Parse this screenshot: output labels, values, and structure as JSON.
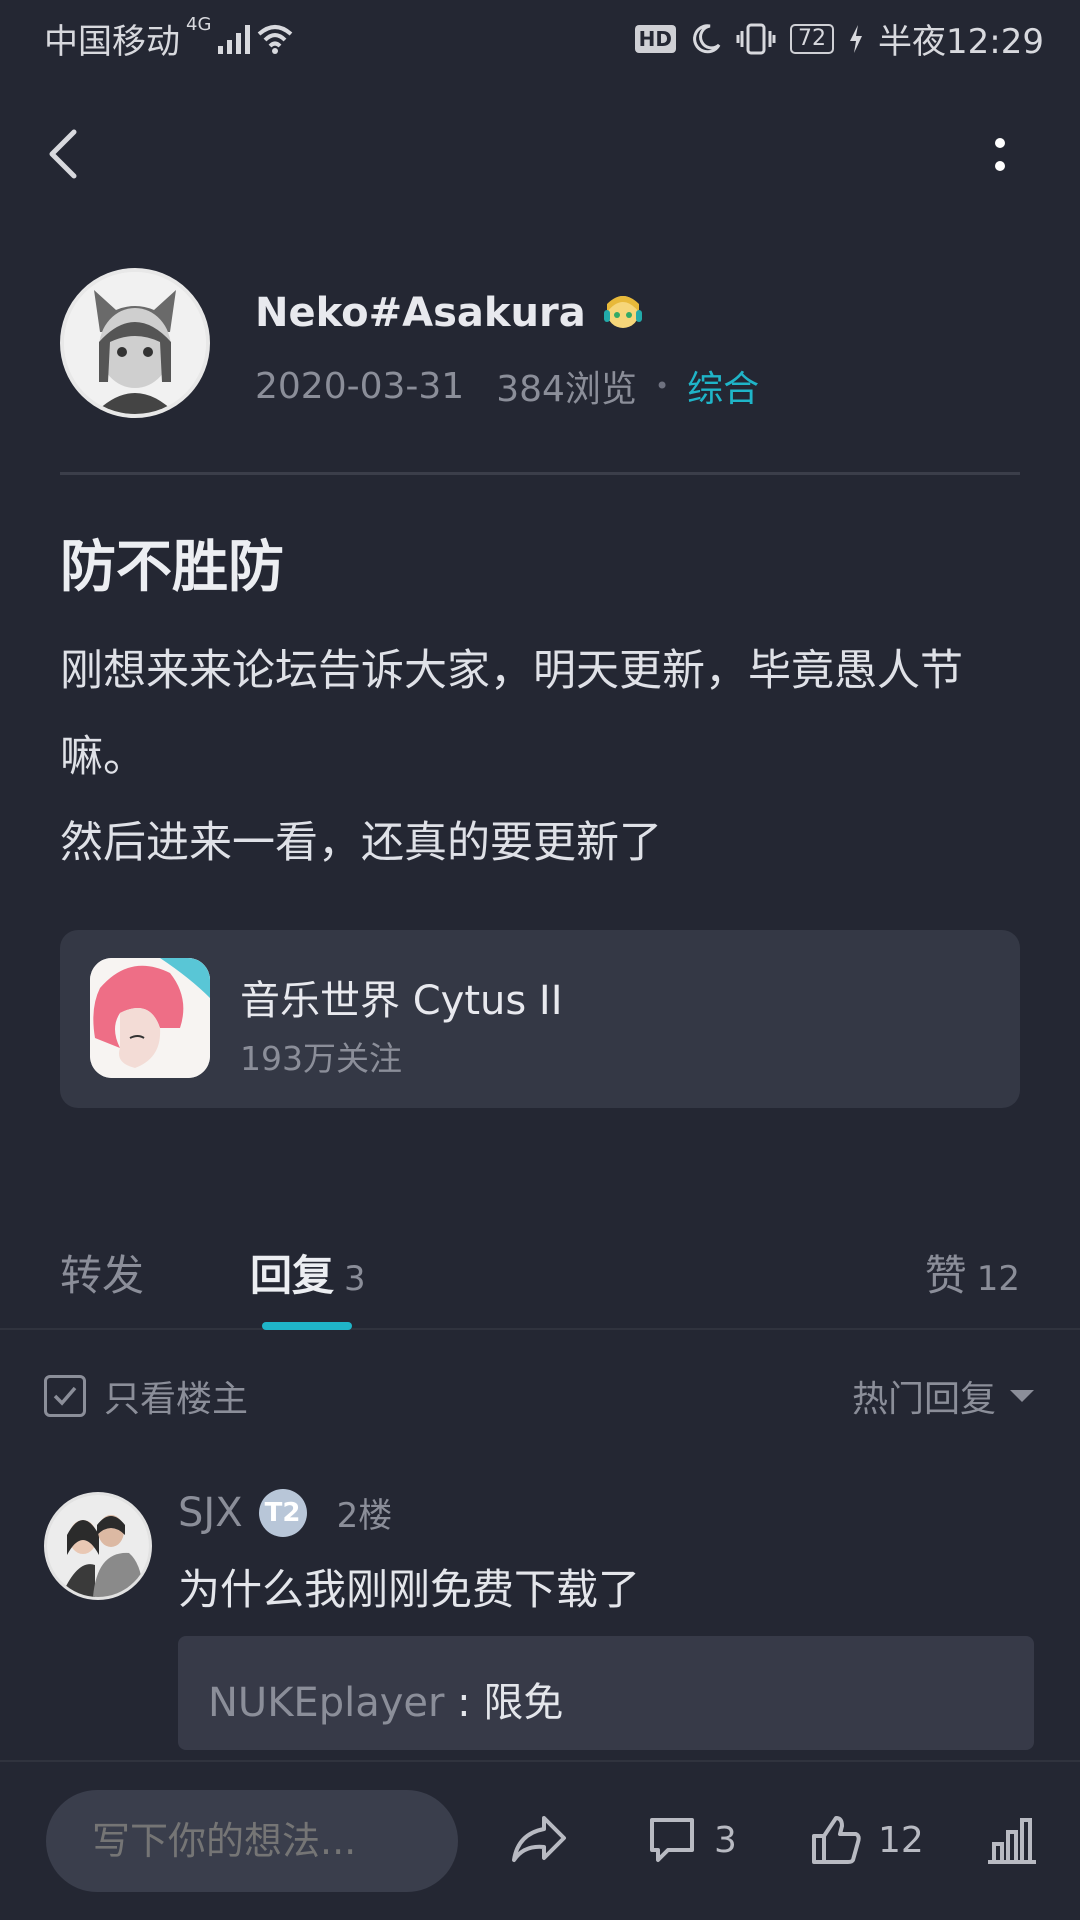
{
  "status_bar": {
    "carrier": "中国移动",
    "network": "4G",
    "hd": "HD",
    "battery": "72",
    "time": "半夜12:29"
  },
  "author": {
    "name": "Neko#Asakura",
    "date": "2020-03-31",
    "views": "384浏览",
    "dot": "•",
    "category": "综合"
  },
  "post": {
    "title": "防不胜防",
    "body_lines": [
      "刚想来来论坛告诉大家，明天更新，毕竟愚人节嘛。",
      "然后进来一看，还真的要更新了"
    ]
  },
  "game": {
    "name": "音乐世界 Cytus II",
    "followers": "193万关注"
  },
  "tabs": {
    "forward": "转发",
    "reply": "回复",
    "reply_count": "3",
    "like": "赞",
    "like_count": "12"
  },
  "filters": {
    "only_op": "只看楼主",
    "sort": "热门回复"
  },
  "reply": {
    "user": "SJX",
    "badge": "T2",
    "floor": "2楼",
    "text": "为什么我刚刚免费下载了",
    "sub_reply_user": "NUKEplayer",
    "sub_reply_sep": " : ",
    "sub_reply_text": "限免"
  },
  "bottom_bar": {
    "input_placeholder": "写下你的想法...",
    "comment_count": "3",
    "like_count": "12"
  }
}
